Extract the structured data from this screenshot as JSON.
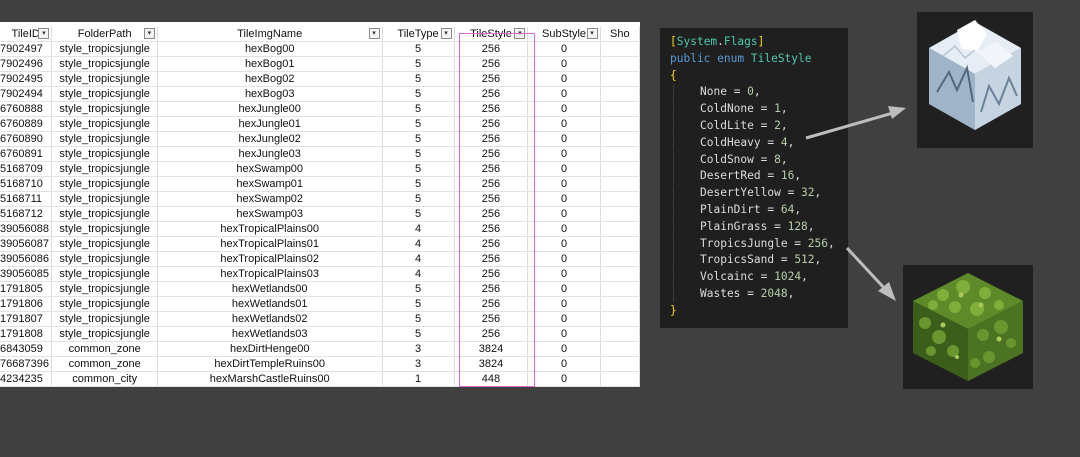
{
  "spreadsheet": {
    "columns": [
      "TileID",
      "FolderPath",
      "TileImgName",
      "TileType",
      "TileStyle",
      "SubStyle",
      "Sho"
    ],
    "rows": [
      [
        "7902497",
        "style_tropicsjungle",
        "hexBog00",
        "5",
        "256",
        "0"
      ],
      [
        "7902496",
        "style_tropicsjungle",
        "hexBog01",
        "5",
        "256",
        "0"
      ],
      [
        "7902495",
        "style_tropicsjungle",
        "hexBog02",
        "5",
        "256",
        "0"
      ],
      [
        "7902494",
        "style_tropicsjungle",
        "hexBog03",
        "5",
        "256",
        "0"
      ],
      [
        "6760888",
        "style_tropicsjungle",
        "hexJungle00",
        "5",
        "256",
        "0"
      ],
      [
        "6760889",
        "style_tropicsjungle",
        "hexJungle01",
        "5",
        "256",
        "0"
      ],
      [
        "6760890",
        "style_tropicsjungle",
        "hexJungle02",
        "5",
        "256",
        "0"
      ],
      [
        "6760891",
        "style_tropicsjungle",
        "hexJungle03",
        "5",
        "256",
        "0"
      ],
      [
        "5168709",
        "style_tropicsjungle",
        "hexSwamp00",
        "5",
        "256",
        "0"
      ],
      [
        "5168710",
        "style_tropicsjungle",
        "hexSwamp01",
        "5",
        "256",
        "0"
      ],
      [
        "5168711",
        "style_tropicsjungle",
        "hexSwamp02",
        "5",
        "256",
        "0"
      ],
      [
        "5168712",
        "style_tropicsjungle",
        "hexSwamp03",
        "5",
        "256",
        "0"
      ],
      [
        "39056088",
        "style_tropicsjungle",
        "hexTropicalPlains00",
        "4",
        "256",
        "0"
      ],
      [
        "39056087",
        "style_tropicsjungle",
        "hexTropicalPlains01",
        "4",
        "256",
        "0"
      ],
      [
        "39056086",
        "style_tropicsjungle",
        "hexTropicalPlains02",
        "4",
        "256",
        "0"
      ],
      [
        "39056085",
        "style_tropicsjungle",
        "hexTropicalPlains03",
        "4",
        "256",
        "0"
      ],
      [
        "1791805",
        "style_tropicsjungle",
        "hexWetlands00",
        "5",
        "256",
        "0"
      ],
      [
        "1791806",
        "style_tropicsjungle",
        "hexWetlands01",
        "5",
        "256",
        "0"
      ],
      [
        "1791807",
        "style_tropicsjungle",
        "hexWetlands02",
        "5",
        "256",
        "0"
      ],
      [
        "1791808",
        "style_tropicsjungle",
        "hexWetlands03",
        "5",
        "256",
        "0"
      ],
      [
        "6843059",
        "common_zone",
        "hexDirtHenge00",
        "3",
        "3824",
        "0"
      ],
      [
        "76687396",
        "common_zone",
        "hexDirtTempleRuins00",
        "3",
        "3824",
        "0"
      ],
      [
        "4234235",
        "common_city",
        "hexMarshCastleRuins00",
        "1",
        "448",
        "0"
      ]
    ]
  },
  "code": {
    "attribute_open": "[",
    "attribute_ns": "System",
    "attribute_dot": ".",
    "attribute_name": "Flags",
    "attribute_close": "]",
    "kw_public": "public",
    "kw_enum": "enum",
    "enum_name": "TileStyle",
    "open_brace": "{",
    "close_brace": "}",
    "members": [
      {
        "name": "None",
        "value": "0"
      },
      {
        "name": "ColdNone",
        "value": "1"
      },
      {
        "name": "ColdLite",
        "value": "2"
      },
      {
        "name": "ColdHeavy",
        "value": "4"
      },
      {
        "name": "ColdSnow",
        "value": "8"
      },
      {
        "name": "DesertRed",
        "value": "16"
      },
      {
        "name": "DesertYellow",
        "value": "32"
      },
      {
        "name": "PlainDirt",
        "value": "64"
      },
      {
        "name": "PlainGrass",
        "value": "128"
      },
      {
        "name": "TropicsJungle",
        "value": "256"
      },
      {
        "name": "TropicsSand",
        "value": "512"
      },
      {
        "name": "Volcainc",
        "value": "1024"
      },
      {
        "name": "Wastes",
        "value": "2048"
      }
    ]
  },
  "tiles": {
    "snow_icon": "snow-mountain-tile-icon",
    "jungle_icon": "jungle-tile-icon"
  },
  "colors": {
    "background": "#404040",
    "highlight_border": "#d76ad0",
    "code_background": "#1f1f1f",
    "keyword": "#569cd6",
    "type": "#4ec9b0",
    "number": "#b5cea8"
  }
}
